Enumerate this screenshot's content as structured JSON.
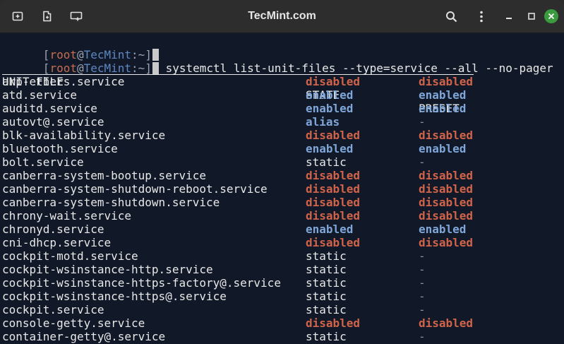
{
  "window": {
    "title": "TecMint.com"
  },
  "terminal": {
    "prompts": [
      {
        "open": "[",
        "user": "root",
        "at": "@",
        "host": "TecMint",
        "path": ":~",
        "close": "]",
        "command": ""
      },
      {
        "open": "[",
        "user": "root",
        "at": "@",
        "host": "TecMint",
        "path": ":~",
        "close": "]",
        "command": " systemctl list-unit-files --type=service --all --no-pager"
      }
    ],
    "headers": {
      "unit": "UNIT FILE",
      "state": "STATE",
      "preset": "PRESET"
    },
    "rows": [
      {
        "unit": "arp-ethers.service",
        "state": "disabled",
        "preset": "disabled"
      },
      {
        "unit": "atd.service",
        "state": "enabled",
        "preset": "enabled"
      },
      {
        "unit": "auditd.service",
        "state": "enabled",
        "preset": "enabled"
      },
      {
        "unit": "autovt@.service",
        "state": "alias",
        "preset": "-"
      },
      {
        "unit": "blk-availability.service",
        "state": "disabled",
        "preset": "disabled"
      },
      {
        "unit": "bluetooth.service",
        "state": "enabled",
        "preset": "enabled"
      },
      {
        "unit": "bolt.service",
        "state": "static",
        "preset": "-"
      },
      {
        "unit": "canberra-system-bootup.service",
        "state": "disabled",
        "preset": "disabled"
      },
      {
        "unit": "canberra-system-shutdown-reboot.service",
        "state": "disabled",
        "preset": "disabled"
      },
      {
        "unit": "canberra-system-shutdown.service",
        "state": "disabled",
        "preset": "disabled"
      },
      {
        "unit": "chrony-wait.service",
        "state": "disabled",
        "preset": "disabled"
      },
      {
        "unit": "chronyd.service",
        "state": "enabled",
        "preset": "enabled"
      },
      {
        "unit": "cni-dhcp.service",
        "state": "disabled",
        "preset": "disabled"
      },
      {
        "unit": "cockpit-motd.service",
        "state": "static",
        "preset": "-"
      },
      {
        "unit": "cockpit-wsinstance-http.service",
        "state": "static",
        "preset": "-"
      },
      {
        "unit": "cockpit-wsinstance-https-factory@.service",
        "state": "static",
        "preset": "-"
      },
      {
        "unit": "cockpit-wsinstance-https@.service",
        "state": "static",
        "preset": "-"
      },
      {
        "unit": "cockpit.service",
        "state": "static",
        "preset": "-"
      },
      {
        "unit": "console-getty.service",
        "state": "disabled",
        "preset": "disabled"
      },
      {
        "unit": "container-getty@.service",
        "state": "static",
        "preset": "-"
      }
    ]
  },
  "colors": {
    "background": "#111827",
    "titlebar": "#2d2d2d",
    "disabled": "#d0644a",
    "enabled": "#7fa6d8",
    "close_button": "#3a9a3e"
  },
  "icons": {
    "new_tab": "new-tab-icon",
    "new_window": "new-window-icon",
    "split": "split-icon",
    "search": "search-icon",
    "menu": "kebab-menu-icon",
    "minimize": "minimize-icon",
    "maximize": "maximize-icon",
    "close": "close-icon"
  }
}
